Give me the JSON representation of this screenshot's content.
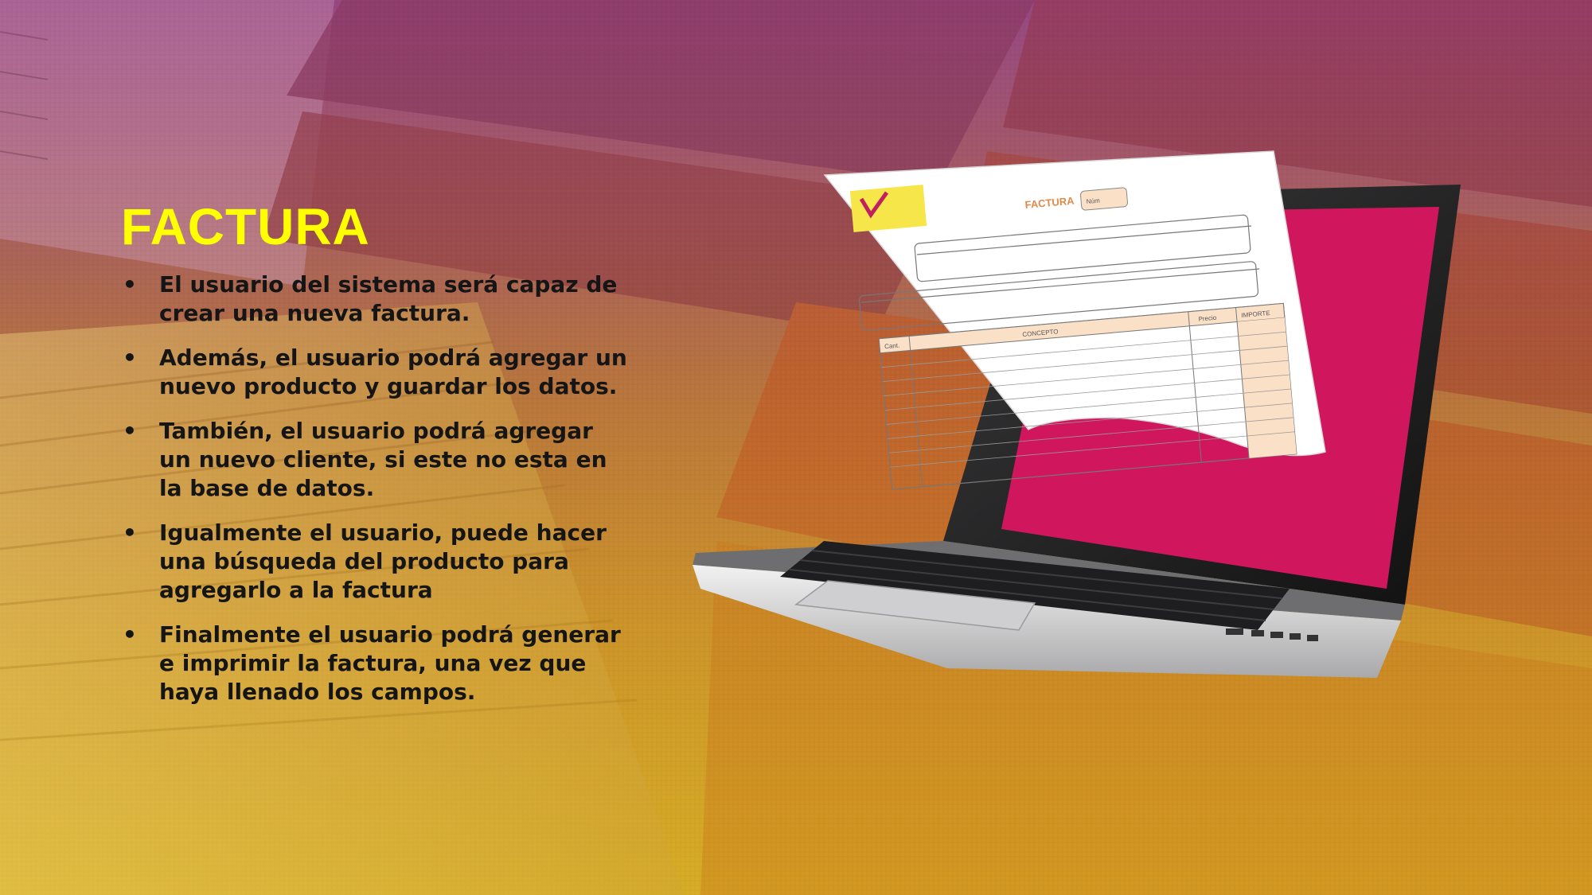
{
  "slide": {
    "title": "FACTURA",
    "bullets": [
      "El usuario del sistema será capaz de crear una nueva factura.",
      "Además, el usuario podrá agregar un nuevo producto y guardar los datos.",
      "También, el usuario podrá agregar un nuevo cliente, si este no esta en la base de datos.",
      "Igualmente el usuario, puede hacer una búsqueda del producto para agregarlo a la factura",
      "Finalmente el usuario podrá generar e imprimir la factura, una vez que haya llenado los campos."
    ]
  },
  "invoice": {
    "heading": "FACTURA",
    "num_label": "Núm",
    "columns": [
      "Cant.",
      "CONCEPTO",
      "Precio",
      "IMPORTE"
    ]
  },
  "colors": {
    "title": "#ffff00",
    "screen": "#d0175d",
    "text": "#151515"
  },
  "icons": [
    "laptop-icon",
    "invoice-document-icon"
  ]
}
